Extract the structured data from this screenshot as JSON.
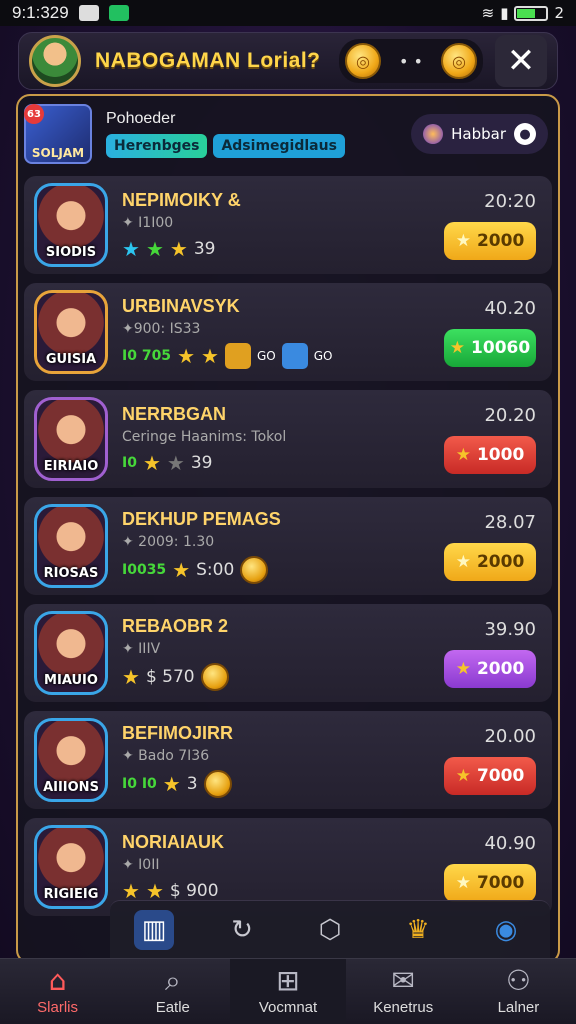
{
  "status": {
    "time": "9:1:329",
    "battery_label": "2"
  },
  "header": {
    "title": "NABOGAMAN Lorial?",
    "coin_dots": "• •",
    "close_label": "✕"
  },
  "player": {
    "badge": "63",
    "thumb_caption": "SOLJAM",
    "name": "Pohoeder",
    "tag1": "Herenbges",
    "tag2": "Adsimegidlaus",
    "mode_label": "Habbar"
  },
  "rows": [
    {
      "caption": "SIODIS",
      "title": "NEPIMOIKY &",
      "sub": "✦ I1I00",
      "stars": [
        "cyan",
        "green",
        "gold"
      ],
      "value": "39",
      "time": "20:20",
      "cost": "2000",
      "pill": "gold"
    },
    {
      "caption": "GUISIA",
      "title": "URBINAVSYK",
      "sub": "✦900: IS33",
      "label": "I0 705",
      "stars": [
        "gold",
        "gold"
      ],
      "value": "",
      "time": "40.20",
      "cost": "10060",
      "pill": "green",
      "extras": [
        "GO",
        "GO"
      ]
    },
    {
      "caption": "EIRIAIO",
      "title": "NERRBGAN",
      "sub": "Ceringe Haanims: Tokol",
      "label": "I0",
      "stars": [
        "gold",
        "grey"
      ],
      "value": "39",
      "time": "20.20",
      "cost": "1000",
      "pill": "red"
    },
    {
      "caption": "RIOSAS",
      "title": "DEKHUP PEMAGS",
      "sub": "✦ 2009: 1.30",
      "label": "I0035",
      "stars": [
        "gold"
      ],
      "value": "S:00",
      "time": "28.07",
      "cost": "2000",
      "pill": "gold"
    },
    {
      "caption": "MIAUIO",
      "title": "REBAOBR 2",
      "sub": "✦ IIIV",
      "label": "",
      "stars": [
        "gold"
      ],
      "value": "$ 570",
      "time": "39.90",
      "cost": "2000",
      "pill": "purple"
    },
    {
      "caption": "AIIIONS",
      "title": "BEFIMOJIRR",
      "sub": "✦ Bado 7I36",
      "label": "I0 I0",
      "stars": [
        "gold"
      ],
      "value": "3",
      "time": "20.00",
      "cost": "7000",
      "pill": "red"
    },
    {
      "caption": "RIGIEIG",
      "title": "NORIAIAUK",
      "sub": "✦ I0II",
      "label": "",
      "stars": [
        "gold",
        "gold"
      ],
      "value": "$ 900",
      "time": "40.90",
      "cost": "7000",
      "pill": "gold"
    }
  ],
  "nav": [
    {
      "label": "Slarlis",
      "icon": "home-icon",
      "active": true
    },
    {
      "label": "Eatle",
      "icon": "search-icon"
    },
    {
      "label": "Vocmnat",
      "icon": "grid-icon",
      "highlight": true
    },
    {
      "label": "Kenetrus",
      "icon": "mail-icon"
    },
    {
      "label": "Lalner",
      "icon": "users-icon"
    }
  ],
  "colors": {
    "accent": "#ffd64a",
    "panel_border": "#c99a48",
    "nav_active": "#ff5a5a"
  }
}
